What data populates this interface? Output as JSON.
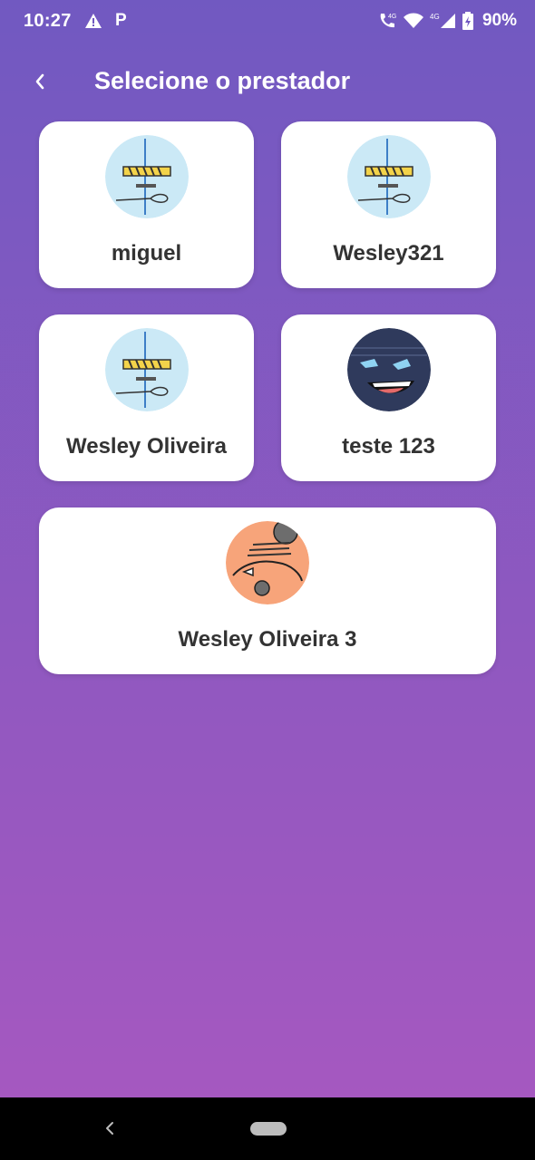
{
  "status_bar": {
    "time": "10:27",
    "battery": "90%",
    "network_label_1": "4G",
    "network_label_2": "4G",
    "icons": [
      "warning-icon",
      "p-icon",
      "call-icon",
      "wifi-icon",
      "signal-icon",
      "battery-icon"
    ]
  },
  "header": {
    "title": "Selecione o prestador",
    "back_icon": "chevron-left-icon"
  },
  "providers": [
    {
      "name": "miguel",
      "avatar": "sketch-blue"
    },
    {
      "name": "Wesley321",
      "avatar": "sketch-blue"
    },
    {
      "name": "Wesley Oliveira",
      "avatar": "sketch-blue"
    },
    {
      "name": "teste 123",
      "avatar": "face-dark"
    },
    {
      "name": "Wesley Oliveira 3",
      "avatar": "face-orange"
    }
  ],
  "colors": {
    "gradient_top": "#7159c1",
    "gradient_bottom": "#a858c0",
    "card_bg": "#ffffff",
    "card_text": "#333333"
  },
  "nav_bar": {
    "icons": [
      "nav-back-icon",
      "nav-home-pill"
    ]
  }
}
